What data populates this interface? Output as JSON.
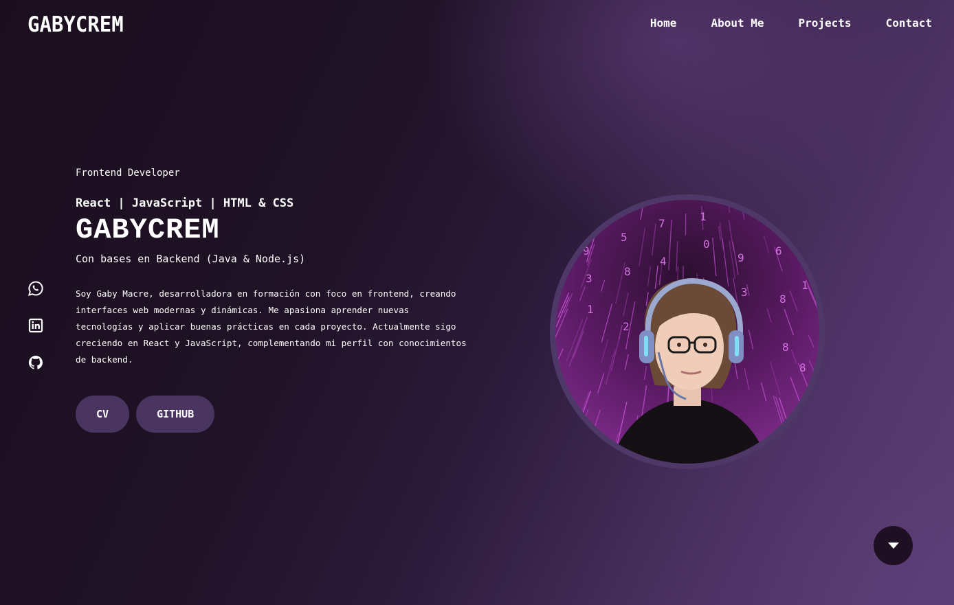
{
  "header": {
    "logo": "GABYCREM",
    "nav": [
      {
        "label": "Home"
      },
      {
        "label": "About Me"
      },
      {
        "label": "Projects"
      },
      {
        "label": "Contact"
      }
    ]
  },
  "socials": [
    {
      "icon": "whatsapp-icon"
    },
    {
      "icon": "linkedin-icon"
    },
    {
      "icon": "github-icon"
    }
  ],
  "hero": {
    "role": "Frontend Developer",
    "stack": "React | JavaScript | HTML & CSS",
    "name": "GABYCREM",
    "subtitle": "Con bases en Backend (Java & Node.js)",
    "description": "Soy Gaby Macre, desarrolladora en formación con foco en frontend, creando interfaces web modernas y dinámicas. Me apasiona aprender nuevas tecnologías y aplicar buenas prácticas en cada proyecto. Actualmente sigo creciendo en React y JavaScript, complementando mi perfil con conocimientos de backend.",
    "buttons": [
      {
        "label": "CV"
      },
      {
        "label": "GITHUB"
      }
    ]
  },
  "scroll": {
    "icon": "chevron-down-icon"
  },
  "colors": {
    "accent": "#4a3560",
    "ring": "#4d3868",
    "scroll_bg": "#1e0f22",
    "matrix": "#c03ad0"
  }
}
